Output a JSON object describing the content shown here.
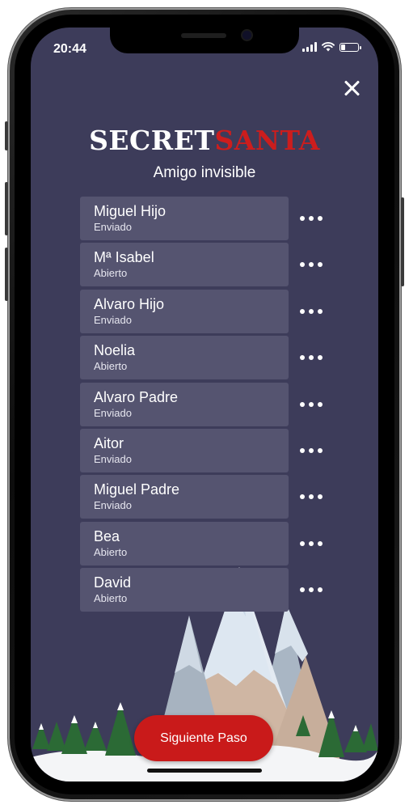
{
  "status": {
    "time": "20:44"
  },
  "header": {
    "logo_part1": "SECRET",
    "logo_part2": "SANTA",
    "subtitle": "Amigo invisible"
  },
  "participants": [
    {
      "name": "Miguel Hijo",
      "status": "Enviado"
    },
    {
      "name": "Mª Isabel",
      "status": "Abierto"
    },
    {
      "name": "Alvaro Hijo",
      "status": "Enviado"
    },
    {
      "name": "Noelia",
      "status": "Abierto"
    },
    {
      "name": "Alvaro Padre",
      "status": "Enviado"
    },
    {
      "name": "Aitor",
      "status": "Enviado"
    },
    {
      "name": "Miguel Padre",
      "status": "Enviado"
    },
    {
      "name": "Bea",
      "status": "Abierto"
    },
    {
      "name": "David",
      "status": "Abierto"
    }
  ],
  "footer": {
    "next_label": "Siguiente Paso"
  },
  "icons": {
    "close": "close-icon",
    "more": "more-options-icon"
  },
  "colors": {
    "background": "#3d3c5a",
    "card": "#555470",
    "accent": "#c91a1a"
  }
}
